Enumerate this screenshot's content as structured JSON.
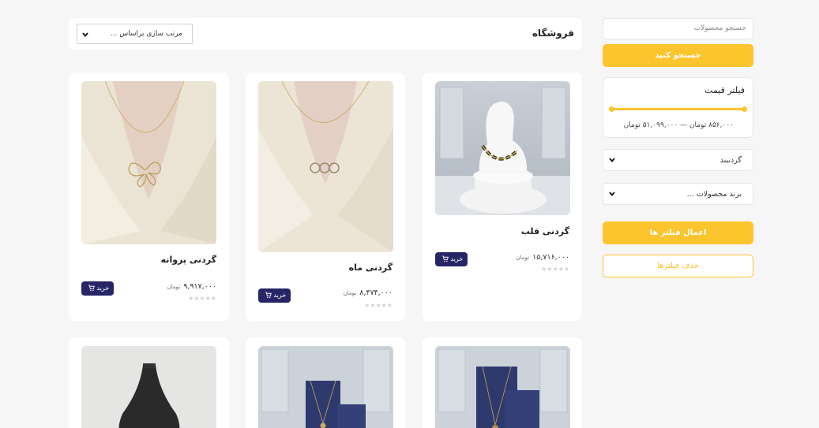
{
  "sidebar": {
    "search_placeholder": "جستجو محصولات",
    "search_button": "جستجو کنید",
    "price_filter_title": "فیلتر قیمت",
    "price_range": "۸۵۶,۰۰۰ تومان — ۵۱,۰۹۹,۰۰۰ تومان",
    "category_select": "گردنبند",
    "brand_select": "برند محصولات ...",
    "apply_button": "اعمال فیلتر ها",
    "clear_button": "حذف فیلترها",
    "accent_color": "#fcc42d"
  },
  "header": {
    "title": "فروشگاه",
    "sort_select": "مرتب سازی براساس ..."
  },
  "products": [
    {
      "name": "گردنی قلب",
      "price": "۱۵,۷۱۶,۰۰۰",
      "currency": "تومان",
      "buy": "خرید",
      "rating": 0
    },
    {
      "name": "گردنی ماه",
      "price": "۸,۴۷۴,۰۰۰",
      "currency": "تومان",
      "buy": "خرید",
      "rating": 0
    },
    {
      "name": "گردنی پروانه",
      "price": "۹,۹۱۷,۰۰۰",
      "currency": "تومان",
      "buy": "خرید",
      "rating": 0
    }
  ],
  "buy_button_color": "#262667"
}
